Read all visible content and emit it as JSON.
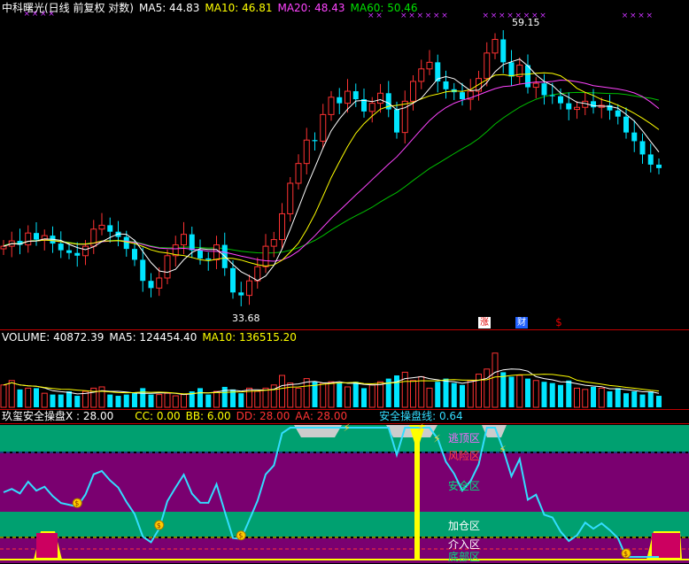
{
  "price_panel": {
    "title": "中科曙光(日线 前复权 对数)",
    "ma5_label": "MA5: 44.83",
    "ma10_label": "MA10: 46.81",
    "ma20_label": "MA20: 48.43",
    "ma60_label": "MA60: 50.46",
    "high_label": "59.15",
    "low_label": "33.68",
    "event_markers": [
      "涨",
      "财",
      "$"
    ]
  },
  "volume_panel": {
    "volume_label": "VOLUME: 40872.39",
    "ma5_label": "MA5: 124454.40",
    "ma10_label": "MA10: 136515.20"
  },
  "indicator_panel": {
    "title": "玖玺安全操盘X : 28.00",
    "cc_label": "CC: 0.00",
    "bb_label": "BB: 6.00",
    "dd_label": "DD: 28.00",
    "aa_label": "AA: 28.00",
    "line_label": "安全操盘线: 0.64",
    "zones": [
      "逃顶区",
      "风险区",
      "安全区",
      "加仓区",
      "介入区",
      "底部区"
    ]
  },
  "colors": {
    "up": "#ff3232",
    "down": "#00e5ff",
    "ma5": "#ffffff",
    "ma10": "#ffff00",
    "ma20": "#ff44ff",
    "ma60": "#00c000",
    "panel_line": "#ff0000",
    "zone_green": "#00a070",
    "zone_purple": "#7a0070",
    "safe_line": "#33ddff"
  },
  "chart_data": [
    {
      "type": "candlestick",
      "series": [
        {
          "name": "MA5",
          "value": 44.83
        },
        {
          "name": "MA10",
          "value": 46.81
        },
        {
          "name": "MA20",
          "value": 48.43
        },
        {
          "name": "MA60",
          "value": 50.46
        }
      ],
      "annotations": [
        {
          "label": "59.15",
          "kind": "period high"
        },
        {
          "label": "33.68",
          "kind": "period low"
        }
      ],
      "close_trend": [
        38.5,
        38.9,
        38.6,
        39.5,
        39.0,
        39.3,
        38.7,
        38.2,
        38.0,
        37.8,
        38.5,
        39.8,
        40.1,
        39.6,
        39.2,
        38.3,
        37.5,
        36.0,
        35.5,
        36.2,
        37.8,
        38.6,
        39.4,
        38.2,
        37.6,
        37.5,
        38.6,
        36.9,
        35.2,
        35.0,
        36.0,
        37.0,
        38.5,
        39.0,
        41.0,
        43.5,
        45.2,
        47.3,
        47.2,
        49.7,
        51.4,
        50.8,
        52.0,
        51.2,
        50.0,
        50.8,
        51.8,
        50.2,
        48.0,
        51.0,
        53.0,
        54.3,
        55.0,
        53.0,
        52.2,
        51.9,
        51.2,
        52.0,
        53.3,
        56.0,
        57.5,
        55.0,
        53.5,
        54.7,
        52.4,
        52.8,
        51.6,
        51.5,
        50.8,
        50.2,
        50.4,
        51.0,
        50.4,
        50.6,
        50.1,
        49.5,
        48.0,
        47.2,
        46.0,
        45.1,
        44.8
      ]
    },
    {
      "type": "bar",
      "title": "VOLUME",
      "series": [
        {
          "name": "VOLUME",
          "value": 40872.39
        },
        {
          "name": "MA5",
          "value": 124454.4
        },
        {
          "name": "MA10",
          "value": 136515.2
        }
      ],
      "relative_values": [
        0.35,
        0.42,
        0.28,
        0.3,
        0.3,
        0.22,
        0.2,
        0.2,
        0.25,
        0.18,
        0.25,
        0.3,
        0.32,
        0.2,
        0.18,
        0.2,
        0.22,
        0.3,
        0.2,
        0.2,
        0.22,
        0.18,
        0.2,
        0.25,
        0.3,
        0.2,
        0.25,
        0.32,
        0.28,
        0.22,
        0.3,
        0.25,
        0.3,
        0.35,
        0.5,
        0.38,
        0.3,
        0.45,
        0.4,
        0.38,
        0.4,
        0.38,
        0.32,
        0.4,
        0.3,
        0.35,
        0.4,
        0.45,
        0.5,
        0.55,
        0.42,
        0.48,
        0.3,
        0.4,
        0.45,
        0.38,
        0.35,
        0.42,
        0.52,
        0.6,
        0.85,
        0.55,
        0.48,
        0.5,
        0.45,
        0.42,
        0.4,
        0.38,
        0.35,
        0.42,
        0.3,
        0.28,
        0.32,
        0.3,
        0.25,
        0.3,
        0.22,
        0.25,
        0.2,
        0.25,
        0.18
      ]
    },
    {
      "type": "line",
      "title": "玖玺安全操盘X",
      "series": [
        {
          "name": "安全操盘线",
          "value": 0.64
        }
      ],
      "categories": [
        "逃顶区",
        "风险区",
        "安全区",
        "加仓区",
        "介入区",
        "底部区"
      ]
    }
  ]
}
